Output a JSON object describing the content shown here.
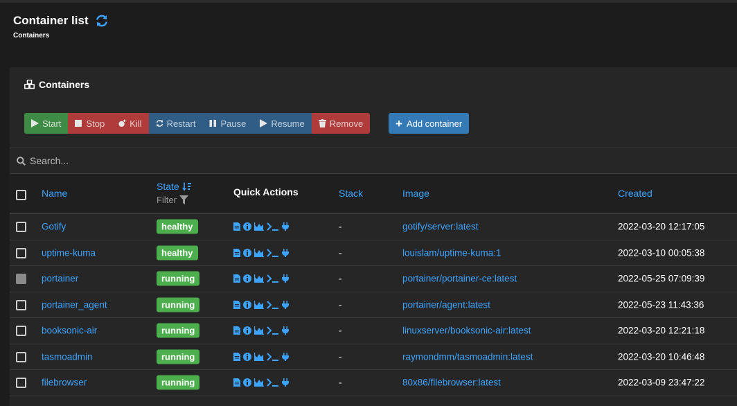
{
  "header": {
    "title": "Container list",
    "breadcrumb": "Containers"
  },
  "widget": {
    "title": "Containers"
  },
  "actions": {
    "start": "Start",
    "stop": "Stop",
    "kill": "Kill",
    "restart": "Restart",
    "pause": "Pause",
    "resume": "Resume",
    "remove": "Remove",
    "add": "Add container"
  },
  "search": {
    "placeholder": "Search..."
  },
  "columns": {
    "name": "Name",
    "state": "State",
    "filter": "Filter",
    "quick_actions": "Quick Actions",
    "stack": "Stack",
    "image": "Image",
    "created": "Created"
  },
  "rows": [
    {
      "name": "Gotify",
      "state": "healthy",
      "stack": "-",
      "image": "gotify/server:latest",
      "created": "2022-03-20 12:17:05",
      "selectable": true
    },
    {
      "name": "uptime-kuma",
      "state": "healthy",
      "stack": "-",
      "image": "louislam/uptime-kuma:1",
      "created": "2022-03-10 00:05:38",
      "selectable": true
    },
    {
      "name": "portainer",
      "state": "running",
      "stack": "-",
      "image": "portainer/portainer-ce:latest",
      "created": "2022-05-25 07:09:39",
      "selectable": false
    },
    {
      "name": "portainer_agent",
      "state": "running",
      "stack": "-",
      "image": "portainer/agent:latest",
      "created": "2022-05-23 11:43:36",
      "selectable": true
    },
    {
      "name": "booksonic-air",
      "state": "running",
      "stack": "-",
      "image": "linuxserver/booksonic-air:latest",
      "created": "2022-03-20 12:21:18",
      "selectable": true
    },
    {
      "name": "tasmoadmin",
      "state": "running",
      "stack": "-",
      "image": "raymondmm/tasmoadmin:latest",
      "created": "2022-03-20 10:46:48",
      "selectable": true
    },
    {
      "name": "filebrowser",
      "state": "running",
      "stack": "-",
      "image": "80x86/filebrowser:latest",
      "created": "2022-03-09 23:47:22",
      "selectable": true
    }
  ],
  "colors": {
    "accent": "#3ca4ff",
    "healthy": "#4cae4c",
    "running": "#4cae4c"
  },
  "icons": {
    "quick_actions": [
      "logs-icon",
      "inspect-icon",
      "stats-icon",
      "console-icon",
      "attach-icon"
    ]
  }
}
